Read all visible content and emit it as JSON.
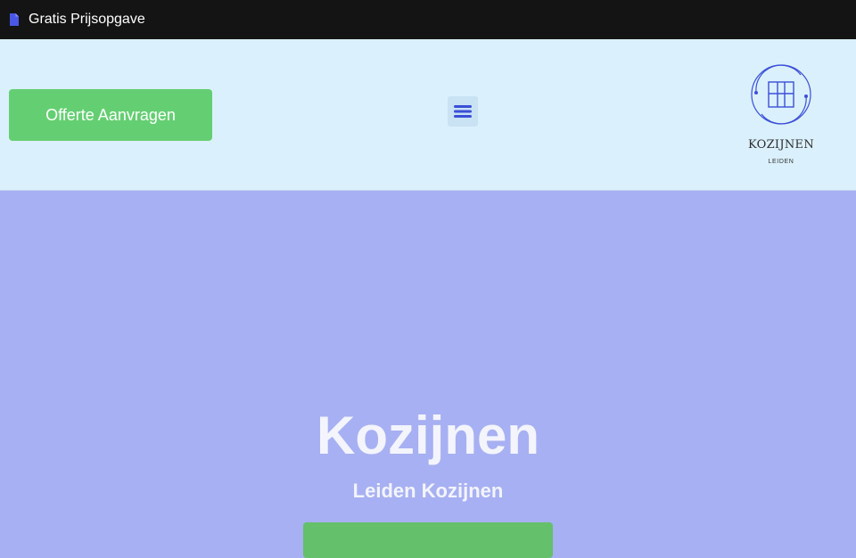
{
  "topbar": {
    "icon": "file-icon",
    "title": "Gratis Prijsopgave"
  },
  "header": {
    "cta_label": "Offerte Aanvragen",
    "menu_icon": "hamburger-menu-icon",
    "logo": {
      "name": "KOZIJNEN",
      "subtitle": "LEIDEN"
    }
  },
  "hero": {
    "title": "Kozijnen",
    "subtitle": "Leiden Kozijnen",
    "button_label": ""
  },
  "colors": {
    "topbar_bg": "#141414",
    "header_bg": "#daf0fc",
    "hero_bg": "#a7b0f2",
    "cta_green": "#64cf72",
    "brand_blue": "#3b4fd8"
  }
}
